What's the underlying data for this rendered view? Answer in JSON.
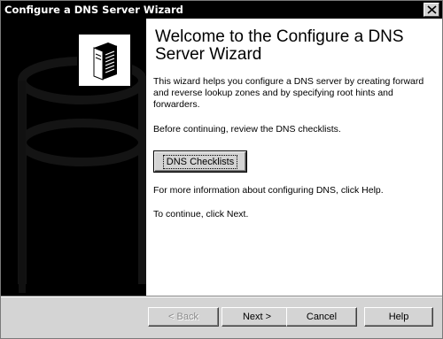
{
  "window": {
    "title": "Configure a DNS Server Wizard"
  },
  "content": {
    "heading": "Welcome to the Configure a DNS Server Wizard",
    "intro": "This wizard helps you configure a DNS server by creating forward and reverse lookup zones and by specifying root hints and forwarders.",
    "review": "Before continuing, review the DNS checklists.",
    "checklists_button": "DNS Checklists",
    "more_info": "For more information about configuring DNS, click Help.",
    "continue": "To continue, click Next."
  },
  "footer": {
    "back_label": "< Back",
    "next_label": "Next >",
    "cancel_label": "Cancel",
    "help_label": "Help"
  },
  "icons": {
    "close": "close-icon",
    "logo": "server-tower-icon"
  },
  "colors": {
    "titlebar": "#000000",
    "sidepanel": "#000000",
    "content_bg": "#ffffff",
    "button_face": "#d4d4d4"
  }
}
